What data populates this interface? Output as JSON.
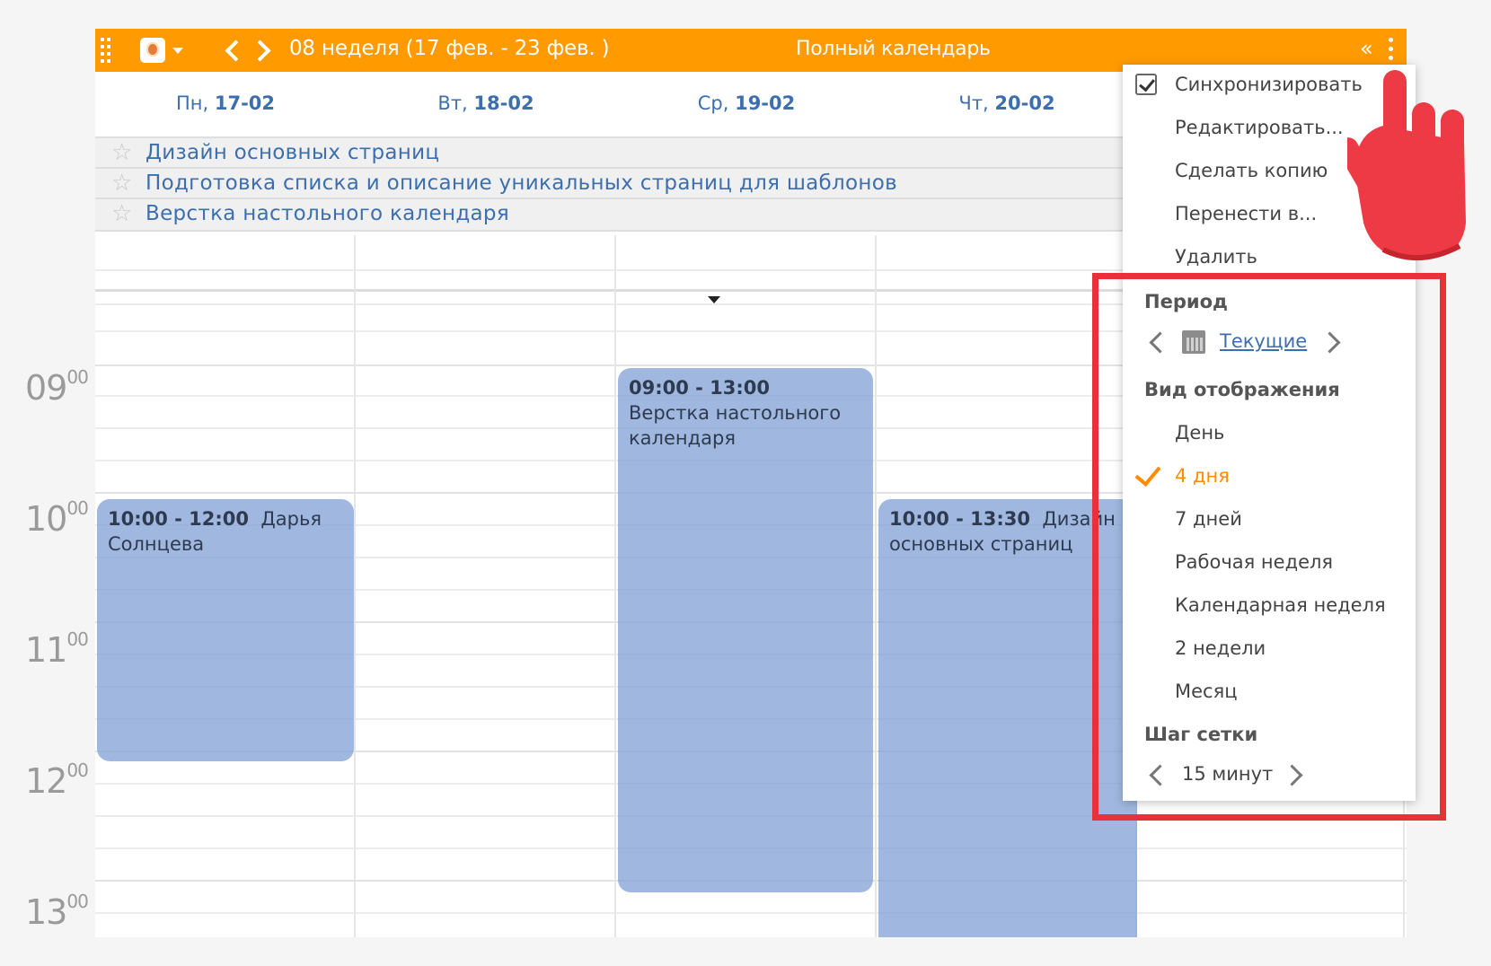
{
  "header": {
    "week_label": "08 неделя  (17 фев. - 23 фев. )",
    "title": "Полный календарь",
    "collapse": "«"
  },
  "days": [
    {
      "dow": "Пн, ",
      "date": "17-02"
    },
    {
      "dow": "Вт, ",
      "date": "18-02"
    },
    {
      "dow": "Ср, ",
      "date": "19-02"
    },
    {
      "dow": "Чт, ",
      "date": "20-02"
    }
  ],
  "tasks": [
    "Дизайн основных страниц",
    "Подготовка списка и описание уникальных страниц для шаблонов",
    "Верстка настольного календаря"
  ],
  "hours": [
    "09",
    "10",
    "11",
    "12",
    "13"
  ],
  "minutes": "00",
  "events": [
    {
      "time": "09:00 - 13:00",
      "title": "Верстка настольного календаря"
    },
    {
      "time": "10:00 - 12:00",
      "title": "Дарья Солнцева"
    },
    {
      "time": "10:00 - 13:30",
      "title": "Дизайн основных страниц"
    }
  ],
  "menu": {
    "sync": "Синхронизировать",
    "edit": "Редактировать...",
    "copy": "Сделать копию",
    "move": "Перенести в...",
    "delete": "Удалить",
    "period_title": "Период",
    "period_value": "Текущие",
    "view_title": "Вид отображения",
    "views": [
      "День",
      "4 дня",
      "7 дней",
      "Рабочая неделя",
      "Календарная неделя",
      "2 недели",
      "Месяц"
    ],
    "selected_view": "4 дня",
    "grid_title": "Шаг сетки",
    "grid_value": "15 минут"
  },
  "colors": {
    "header": "#ff9b00",
    "event": "#8aa8d8",
    "highlight": "#e8323a",
    "hand": "#ee3a44"
  }
}
